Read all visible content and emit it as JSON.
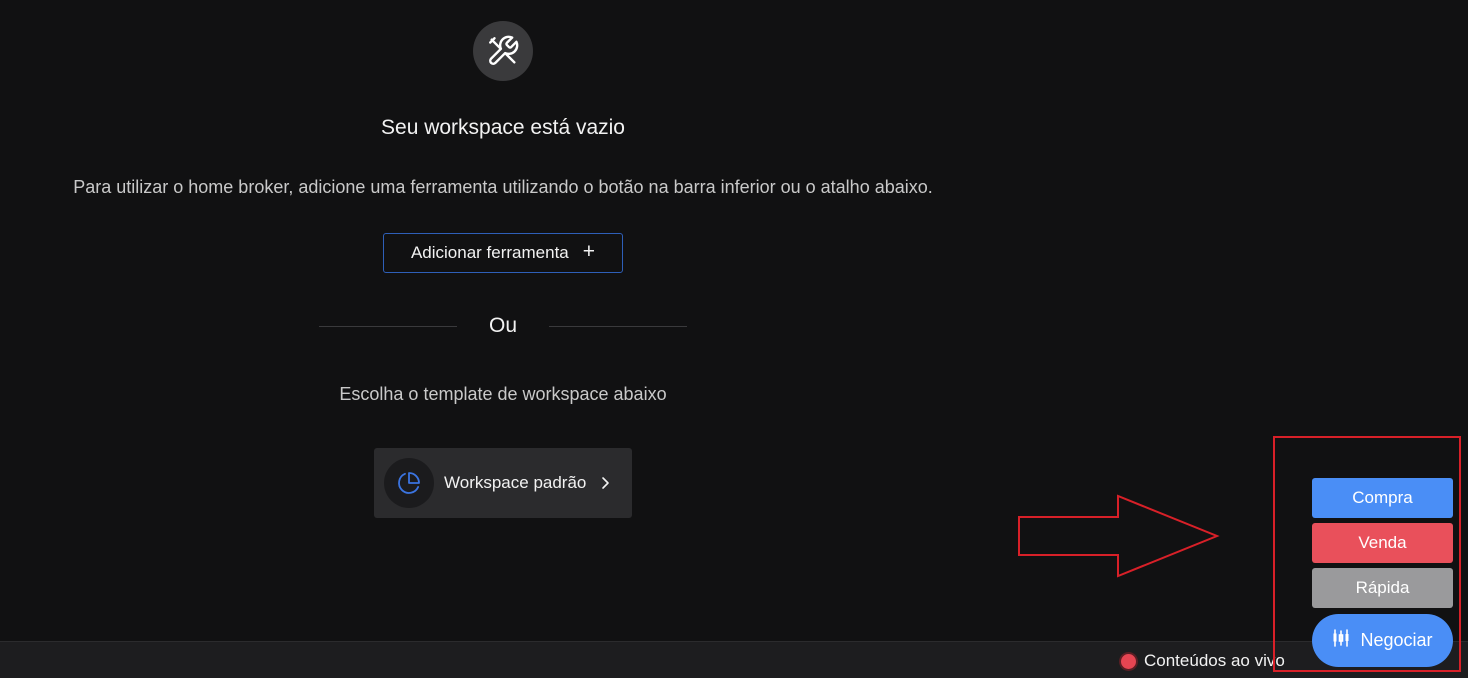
{
  "empty_state": {
    "icon": "tools-icon",
    "title": "Seu workspace está vazio",
    "description": "Para utilizar o home broker, adicione uma ferramenta utilizando o botão na barra inferior ou o atalho abaixo.",
    "add_tool_label": "Adicionar ferramenta",
    "divider_text": "Ou",
    "template_hint": "Escolha o template de workspace abaixo",
    "template_card": {
      "icon": "pie-chart-icon",
      "label": "Workspace padrão"
    }
  },
  "trade_menu": {
    "buy_label": "Compra",
    "sell_label": "Venda",
    "quick_label": "Rápida",
    "negociar_label": "Negociar"
  },
  "bottom_bar": {
    "live_label": "Conteúdos ao vivo"
  },
  "colors": {
    "background": "#111112",
    "accent_blue": "#4a8ef6",
    "sell_red": "#e9505b",
    "quick_gray": "#9a9a9c",
    "annotation_red": "#d82028"
  }
}
